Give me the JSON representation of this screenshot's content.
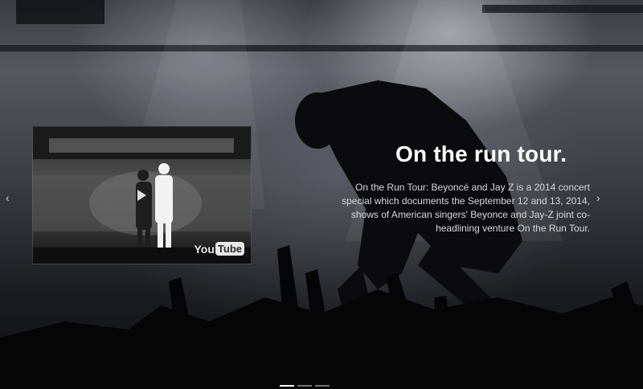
{
  "slide": {
    "title": "On the run tour.",
    "description": "On the Run Tour: Beyoncé and Jay Z is a 2014 concert special which documents the September 12 and 13, 2014, shows of American singers' Beyonce and Jay-Z joint co-headlining venture On the Run Tour."
  },
  "video": {
    "logo_you": "You",
    "logo_tube": "Tube",
    "icon": "play-icon"
  },
  "carousel": {
    "prev_icon": "‹",
    "next_icon": "›",
    "indicator_count": 3,
    "active_index": 0
  }
}
